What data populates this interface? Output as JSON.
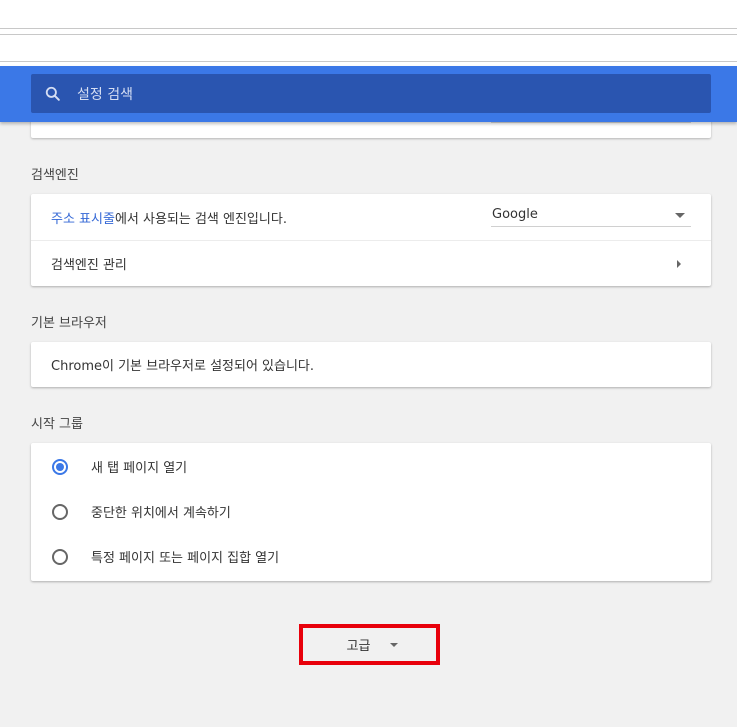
{
  "colors": {
    "header_blue": "#3b78e7",
    "search_bg": "#2a55b0",
    "link_blue": "#3367d6",
    "highlight_red": "#e8000b"
  },
  "header": {
    "search_placeholder": "설정 검색",
    "search_icon": "search-icon"
  },
  "search_engine": {
    "title": "검색엔진",
    "address_bar_link": "주소 표시줄",
    "address_bar_text": "에서 사용되는 검색 엔진입니다.",
    "selected_engine": "Google",
    "manage_label": "검색엔진 관리"
  },
  "default_browser": {
    "title": "기본 브라우저",
    "status_text": "Chrome이 기본 브라우저로 설정되어 있습니다."
  },
  "startup": {
    "title": "시작 그룹",
    "options": [
      {
        "label": "새 탭 페이지 열기",
        "checked": true
      },
      {
        "label": "중단한 위치에서 계속하기",
        "checked": false
      },
      {
        "label": "특정 페이지 또는 페이지 집합 열기",
        "checked": false
      }
    ]
  },
  "advanced": {
    "label": "고급"
  }
}
